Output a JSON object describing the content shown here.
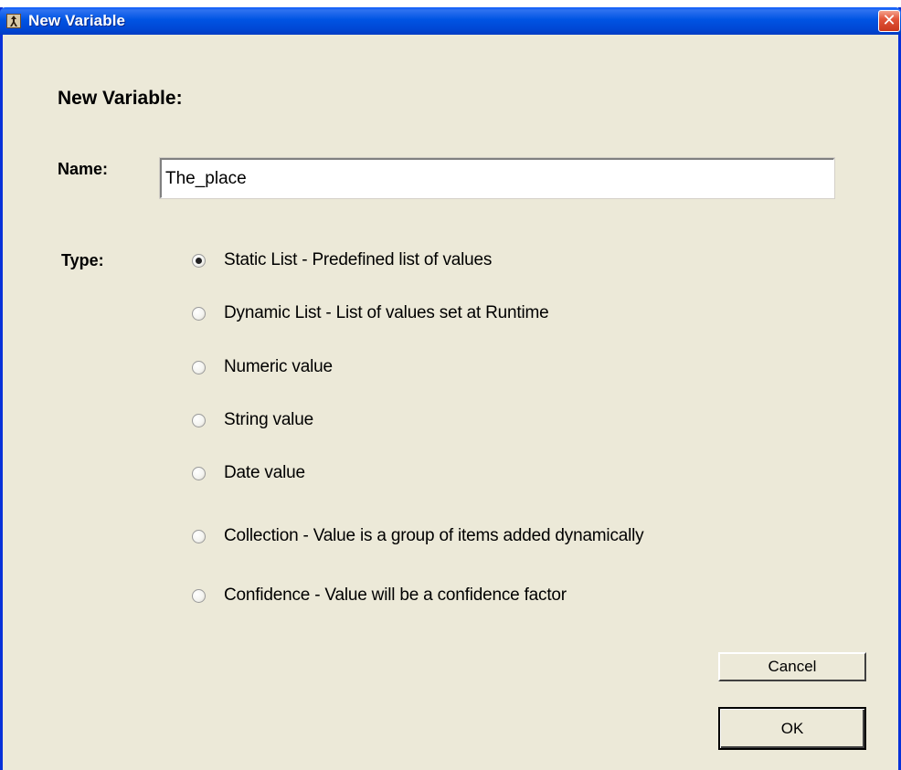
{
  "window": {
    "title": "New Variable",
    "close_glyph": "✕",
    "icon": "app-icon"
  },
  "dialog": {
    "heading": "New Variable:",
    "name_label": "Name:",
    "name_value": "The_place",
    "type_label": "Type:",
    "type_options": [
      {
        "label": "Static List - Predefined list of values",
        "selected": true
      },
      {
        "label": "Dynamic List - List of values set at Runtime",
        "selected": false
      },
      {
        "label": "Numeric value",
        "selected": false
      },
      {
        "label": "String value",
        "selected": false
      },
      {
        "label": "Date value",
        "selected": false
      },
      {
        "label": "Collection - Value is a group of items added dynamically",
        "selected": false
      },
      {
        "label": "Confidence - Value will be a confidence factor",
        "selected": false
      }
    ]
  },
  "buttons": {
    "cancel": "Cancel",
    "ok": "OK"
  },
  "colors": {
    "titlebar": "#0054e3",
    "dialog_bg": "#ece9d8",
    "close_button": "#e2553a"
  }
}
